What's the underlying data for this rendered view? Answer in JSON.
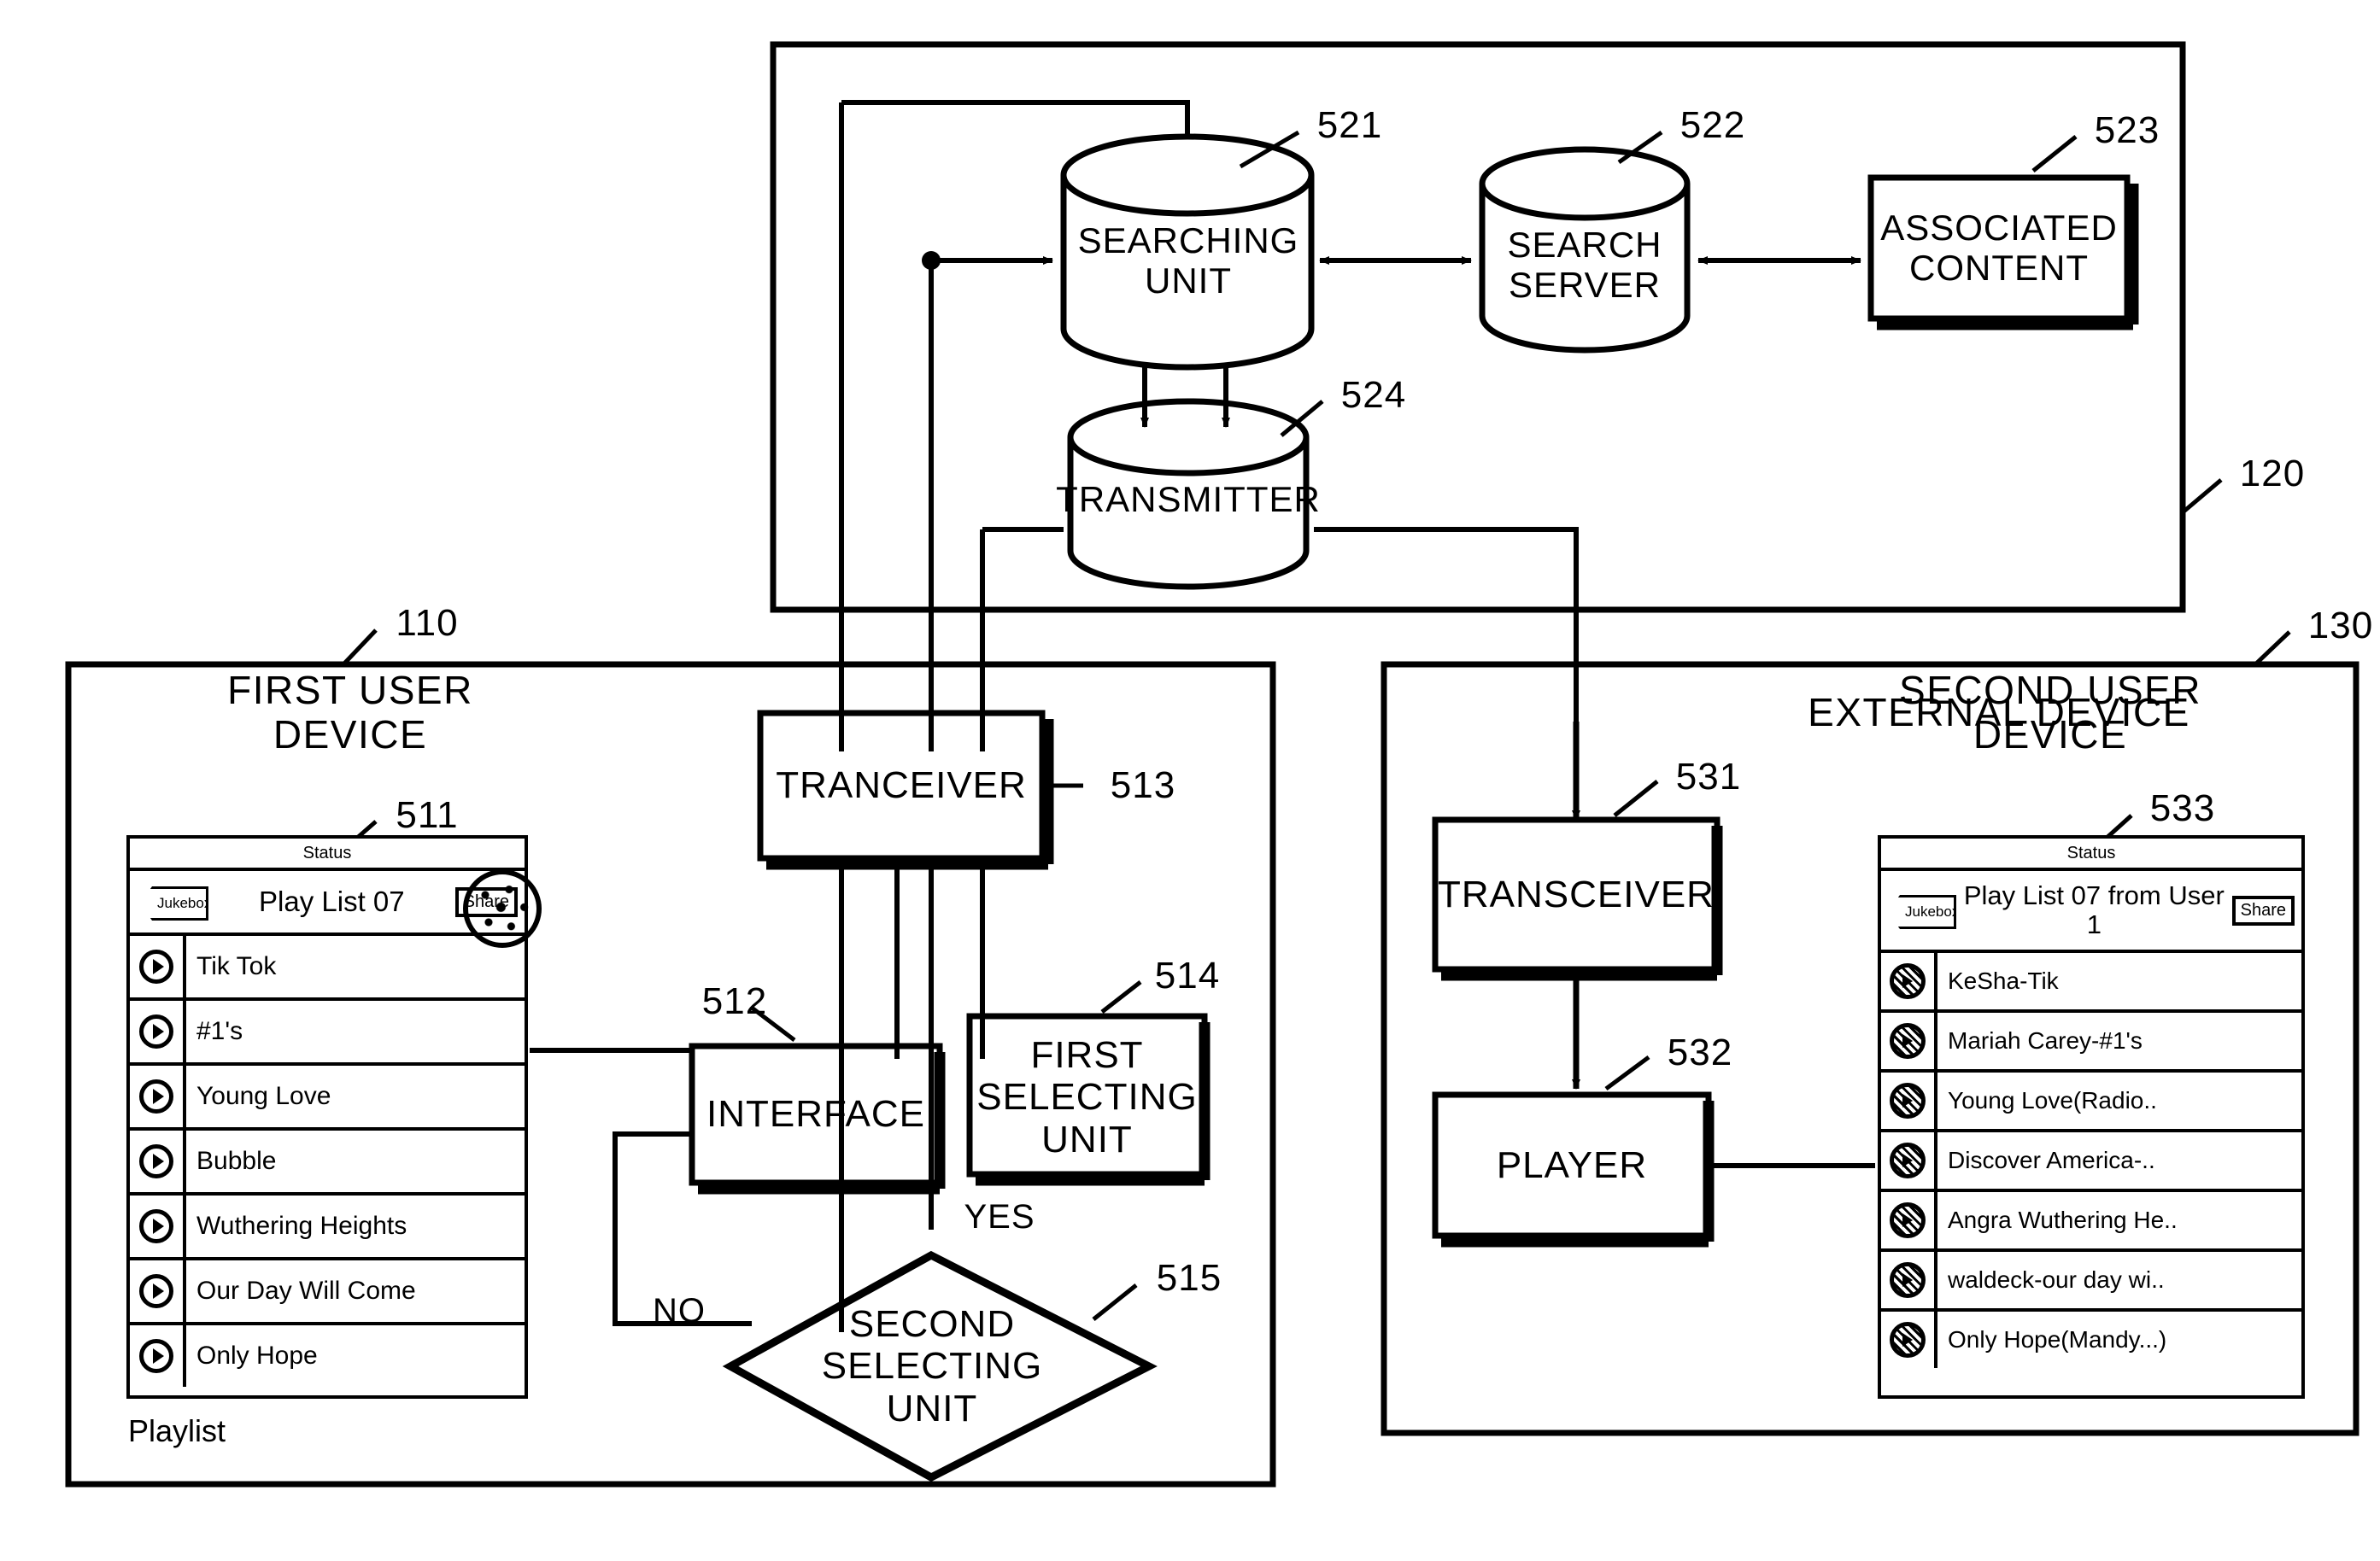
{
  "diagram": {
    "containers": [
      {
        "id": "110",
        "label": "FIRST USER DEVICE"
      },
      {
        "id": "120",
        "label": "EXTERNAL DEVICE"
      },
      {
        "id": "130",
        "label": "SECOND USER DEVICE"
      }
    ],
    "nodes": [
      {
        "id": "521",
        "label": "SEARCHING\nUNIT",
        "shape": "cylinder"
      },
      {
        "id": "522",
        "label": "SEARCH\nSERVER",
        "shape": "cylinder"
      },
      {
        "id": "523",
        "label": "ASSOCIATED\nCONTENT",
        "shape": "box"
      },
      {
        "id": "524",
        "label": "TRANSMITTER",
        "shape": "cylinder"
      },
      {
        "id": "513",
        "label": "TRANCEIVER",
        "shape": "box"
      },
      {
        "id": "512",
        "label": "INTERFACE",
        "shape": "box"
      },
      {
        "id": "514",
        "label": "FIRST\nSELECTING\nUNIT",
        "shape": "box"
      },
      {
        "id": "515",
        "label": "SECOND\nSELECTING\nUNIT",
        "shape": "diamond"
      },
      {
        "id": "531",
        "label": "TRANSCEIVER",
        "shape": "box"
      },
      {
        "id": "532",
        "label": "PLAYER",
        "shape": "box"
      }
    ],
    "edge_labels": {
      "yes": "YES",
      "no": "NO"
    },
    "ref_numbers": [
      "110",
      "120",
      "130",
      "511",
      "512",
      "513",
      "514",
      "515",
      "521",
      "522",
      "523",
      "524",
      "531",
      "532",
      "533"
    ]
  },
  "first_device_screen": {
    "ref": "511",
    "status_label": "Status",
    "back_button": "Jukebox",
    "title": "Play List 07",
    "share_button": "Share",
    "caption": "Playlist",
    "tracks": [
      {
        "icon": "play-icon",
        "title": "Tik Tok"
      },
      {
        "icon": "play-icon",
        "title": "#1's"
      },
      {
        "icon": "play-icon",
        "title": "Young Love"
      },
      {
        "icon": "play-icon",
        "title": "Bubble"
      },
      {
        "icon": "play-icon",
        "title": "Wuthering Heights"
      },
      {
        "icon": "play-icon",
        "title": "Our Day Will Come"
      },
      {
        "icon": "play-icon",
        "title": "Only Hope"
      }
    ]
  },
  "second_device_screen": {
    "ref": "533",
    "status_label": "Status",
    "back_button": "Jukebox",
    "title": "Play List 07\nfrom User 1",
    "share_button": "Share",
    "tracks": [
      {
        "icon": "album-art-icon",
        "title": "KeSha-Tik"
      },
      {
        "icon": "album-art-icon",
        "title": "Mariah Carey-#1's"
      },
      {
        "icon": "album-art-icon",
        "title": "Young Love(Radio.."
      },
      {
        "icon": "album-art-icon",
        "title": "Discover America-.."
      },
      {
        "icon": "album-art-icon",
        "title": "Angra Wuthering He.."
      },
      {
        "icon": "album-art-icon",
        "title": "waldeck-our day wi.."
      },
      {
        "icon": "album-art-icon",
        "title": "Only Hope(Mandy...)"
      }
    ]
  },
  "colors": {
    "ink": "#000000",
    "paper": "#ffffff"
  }
}
